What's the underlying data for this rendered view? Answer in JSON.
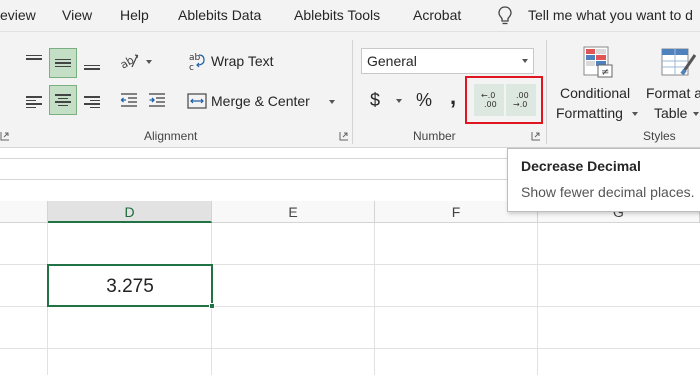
{
  "menu": {
    "tabs": [
      "eview",
      "View",
      "Help",
      "Ablebits Data",
      "Ablebits Tools",
      "Acrobat"
    ],
    "tell_me": "Tell me what you want to d"
  },
  "ribbon": {
    "alignment": {
      "wrap_text": "Wrap Text",
      "merge_center": "Merge & Center",
      "group_label": "Alignment"
    },
    "number": {
      "format_value": "General",
      "currency_symbol": "$",
      "percent_symbol": "%",
      "comma_symbol": ",",
      "increase_decimal": {
        "top": "←.0",
        "bottom": ".00"
      },
      "decrease_decimal": {
        "top": ".00",
        "bottom": "→.0"
      },
      "group_label": "Number"
    },
    "styles": {
      "conditional_formatting": [
        "Conditional",
        "Formatting"
      ],
      "format_as_table": [
        "Format a",
        "Table"
      ],
      "group_label": "Styles"
    }
  },
  "tooltip": {
    "title": "Decrease Decimal",
    "description": "Show fewer decimal places."
  },
  "grid": {
    "columns": [
      "D",
      "E",
      "F",
      "G"
    ],
    "selected_column": "D",
    "selected_cell_value": "3.275"
  },
  "colors": {
    "accent_green": "#217346",
    "highlight_red": "#e0151f",
    "active_button": "#c5dfc7"
  }
}
